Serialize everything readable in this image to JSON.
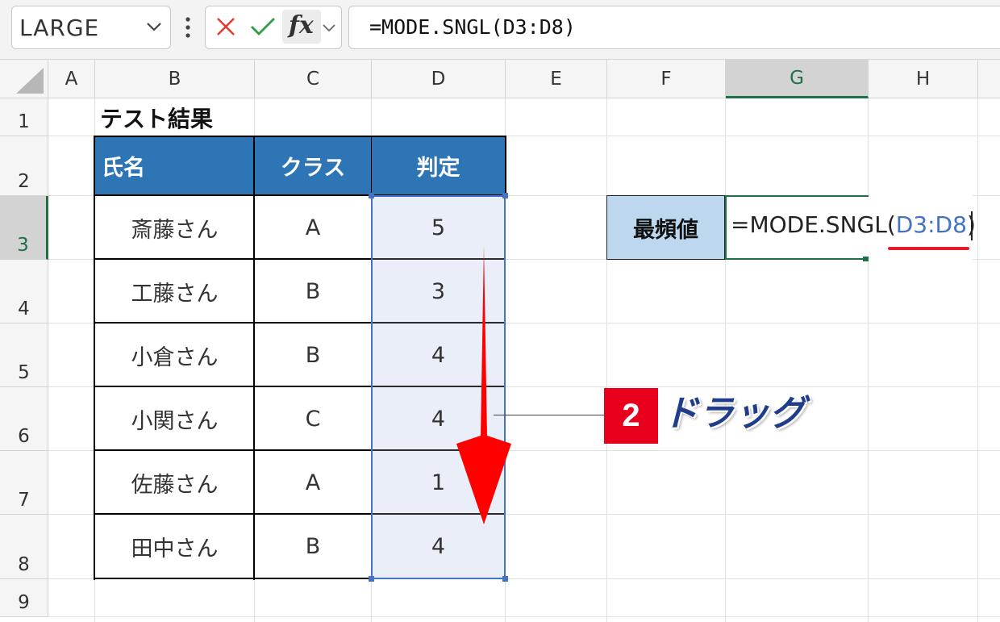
{
  "formula_bar": {
    "name_box": "LARGE",
    "formula": "=MODE.SNGL(D3:D8)",
    "fx_label": "fx",
    "icons": [
      "chevron-down-icon",
      "more-vertical-icon",
      "cancel-x-icon",
      "enter-check-icon",
      "insert-function-icon"
    ]
  },
  "columns": [
    "A",
    "B",
    "C",
    "D",
    "E",
    "F",
    "G",
    "H"
  ],
  "rows": [
    "1",
    "2",
    "3",
    "4",
    "5",
    "6",
    "7",
    "8",
    "9"
  ],
  "selected": {
    "column": "G",
    "row": "3"
  },
  "sheet": {
    "title": "テスト結果",
    "headers": [
      "氏名",
      "クラス",
      "判定"
    ],
    "rows": [
      [
        "斎藤さん",
        "A",
        "5"
      ],
      [
        "工藤さん",
        "B",
        "3"
      ],
      [
        "小倉さん",
        "B",
        "4"
      ],
      [
        "小関さん",
        "C",
        "4"
      ],
      [
        "佐藤さん",
        "A",
        "1"
      ],
      [
        "田中さん",
        "B",
        "4"
      ]
    ],
    "mode_label": "最頻値",
    "edit_prefix": "=MODE.SNGL(",
    "edit_ref": "D3:D8",
    "edit_suffix": ")"
  },
  "annotation": {
    "badge": "2",
    "text": "ドラッグ"
  },
  "colors": {
    "header_fill": "#2e75b6",
    "label_fill": "#bdd7ee",
    "range_border": "#4472c4",
    "range_fill": "#e9eef8",
    "arrow": "#ff0000",
    "badge": "#e8001c",
    "selected_header": "#1e7145"
  }
}
